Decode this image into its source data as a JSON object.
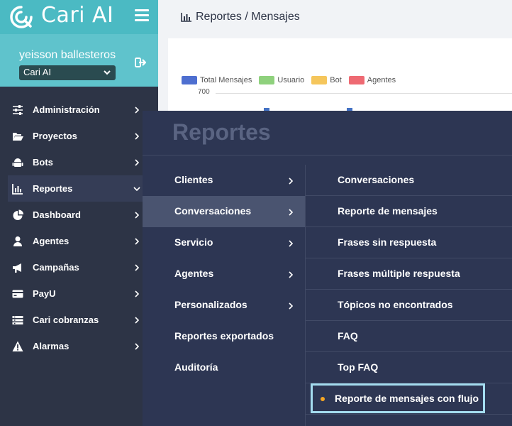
{
  "brand": {
    "name": "Cari AI",
    "logo_icon": "cari-logo-icon",
    "menu_icon": "hamburger-icon"
  },
  "user": {
    "name": "yeisson ballesteros",
    "org_selected": "Cari AI",
    "logout_icon": "logout-icon"
  },
  "sidebar": {
    "items": [
      {
        "label": "Administración",
        "icon": "sliders-icon"
      },
      {
        "label": "Proyectos",
        "icon": "folder-open-icon"
      },
      {
        "label": "Bots",
        "icon": "android-icon"
      },
      {
        "label": "Reportes",
        "icon": "bar-chart-icon",
        "active": true
      },
      {
        "label": "Dashboard",
        "icon": "pie-chart-icon"
      },
      {
        "label": "Agentes",
        "icon": "user-icon"
      },
      {
        "label": "Campañas",
        "icon": "bullhorn-icon"
      },
      {
        "label": "PayU",
        "icon": "credit-card-icon"
      },
      {
        "label": "Cari cobranzas",
        "icon": "list-icon"
      },
      {
        "label": "Alarmas",
        "icon": "warning-icon"
      }
    ]
  },
  "header": {
    "breadcrumb": "Reportes / Mensajes"
  },
  "chart_data": {
    "type": "bar",
    "series": [
      {
        "name": "Total Mensajes",
        "color": "#4e6fd0"
      },
      {
        "name": "Usuario",
        "color": "#8fd17d"
      },
      {
        "name": "Bot",
        "color": "#f5c65c"
      },
      {
        "name": "Agentes",
        "color": "#ee6a73"
      }
    ],
    "y_tick_label": "700",
    "legend_position": "top-left"
  },
  "flyout": {
    "title": "Reportes",
    "categories": [
      {
        "label": "Clientes",
        "has_children": true
      },
      {
        "label": "Conversaciones",
        "has_children": true,
        "selected": true
      },
      {
        "label": "Servicio",
        "has_children": true
      },
      {
        "label": "Agentes",
        "has_children": true
      },
      {
        "label": "Personalizados",
        "has_children": true
      },
      {
        "label": "Reportes exportados",
        "has_children": false
      },
      {
        "label": "Auditoría",
        "has_children": false
      }
    ],
    "reports": [
      {
        "label": "Conversaciones"
      },
      {
        "label": "Reporte de mensajes"
      },
      {
        "label": "Frases sin respuesta"
      },
      {
        "label": "Frases múltiple respuesta"
      },
      {
        "label": "Tópicos no encontrados"
      },
      {
        "label": "FAQ"
      },
      {
        "label": "Top FAQ"
      },
      {
        "label": "Reporte de mensajes con flujo",
        "highlighted": true
      }
    ]
  }
}
